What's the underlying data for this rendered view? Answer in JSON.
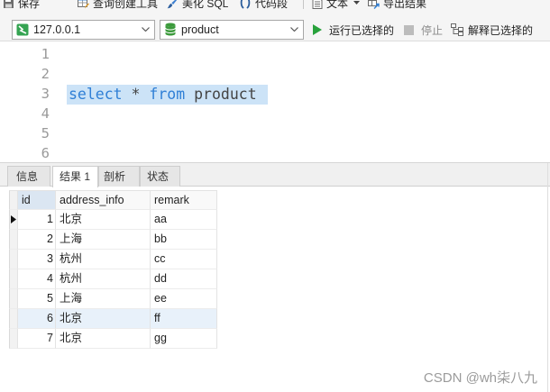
{
  "toolbar": {
    "save": {
      "label": "保存",
      "icon": "save-icon"
    },
    "query_builder": {
      "label": "查询创建工具",
      "icon": "query-builder-icon"
    },
    "beautify_sql": {
      "label": "美化 SQL",
      "icon": "beautify-sql-icon"
    },
    "code_snippet": {
      "label": "代码段",
      "icon": "code-snippet-icon"
    },
    "text": {
      "label": "文本",
      "icon": "text-icon",
      "menu_icon": "dropdown-arrow-icon"
    },
    "export_results": {
      "label": "导出结果",
      "icon": "export-results-icon"
    }
  },
  "query_bar": {
    "connection": {
      "value": "127.0.0.1",
      "icon": "mysql-connection-icon"
    },
    "database": {
      "value": "product",
      "icon": "database-icon"
    },
    "run_selected": {
      "label": "运行已选择的",
      "icon": "run-icon"
    },
    "stop": {
      "label": "停止",
      "icon": "stop-icon",
      "disabled": true
    },
    "explain_selected": {
      "label": "解释已选择的",
      "icon": "explain-icon"
    }
  },
  "editor": {
    "line_numbers": [
      "1",
      "2",
      "3",
      "4",
      "5",
      "6"
    ],
    "code_tokens": [
      "select",
      "*",
      "from",
      "product"
    ]
  },
  "tabs": {
    "items": [
      "信息",
      "结果 1",
      "剖析",
      "状态"
    ],
    "active": 1
  },
  "grid": {
    "columns": [
      "id",
      "address_info",
      "remark"
    ],
    "rows": [
      {
        "id": 1,
        "address_info": "北京",
        "remark": "aa"
      },
      {
        "id": 2,
        "address_info": "上海",
        "remark": "bb"
      },
      {
        "id": 3,
        "address_info": "杭州",
        "remark": "cc"
      },
      {
        "id": 4,
        "address_info": "杭州",
        "remark": "dd"
      },
      {
        "id": 5,
        "address_info": "上海",
        "remark": "ee"
      },
      {
        "id": 6,
        "address_info": "北京",
        "remark": "ff"
      },
      {
        "id": 7,
        "address_info": "北京",
        "remark": "gg"
      }
    ],
    "current_row": 1,
    "highlighted_row": 6
  },
  "watermark": "CSDN @wh柒八九",
  "colors": {
    "keyword": "#2f7fd6",
    "identifier": "#444444",
    "selection": "#cce3f7",
    "line_number": "#9a9a9a",
    "run": "#28a23c",
    "stop": "#bcbcbc",
    "connection": "#35a452",
    "database": "#3b9a3b",
    "row_hover": "#e8f1fa",
    "id_header": "#dbe6f2"
  }
}
